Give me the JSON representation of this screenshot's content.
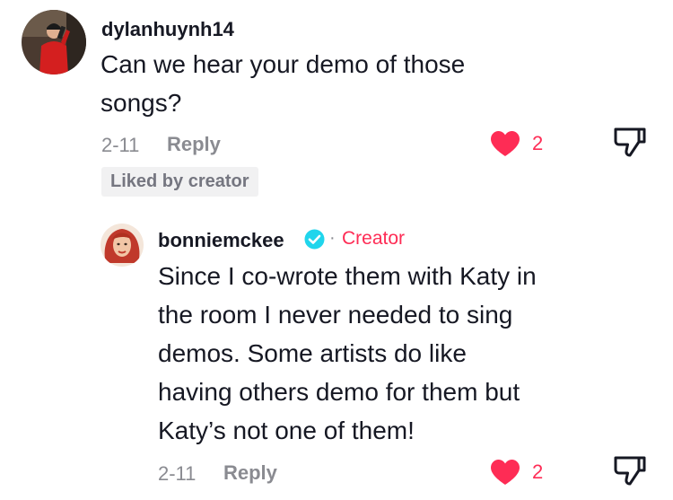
{
  "comments": [
    {
      "username": "dylanhuynh14",
      "text_lines": [
        "Can we hear your demo of those",
        "songs?"
      ],
      "date": "2-11",
      "reply_label": "Reply",
      "like_count": "2",
      "liked_badge": "Liked by creator"
    },
    {
      "username": "bonniemckee",
      "separator": "·",
      "creator_label": "Creator",
      "text_lines": [
        "Since I co-wrote them with Katy in",
        "the room I never needed to sing",
        "demos. Some artists do like",
        "having others demo for them but",
        "Katy’s not one of them!"
      ],
      "date": "2-11",
      "reply_label": "Reply",
      "like_count": "2"
    }
  ],
  "colors": {
    "accent": "#fe2c55",
    "verified": "#20d5ec",
    "muted": "#8a8b91",
    "text": "#161823"
  },
  "icons": {
    "like": "heart-icon",
    "dislike": "thumbs-down-icon",
    "verified": "verified-badge-icon"
  }
}
